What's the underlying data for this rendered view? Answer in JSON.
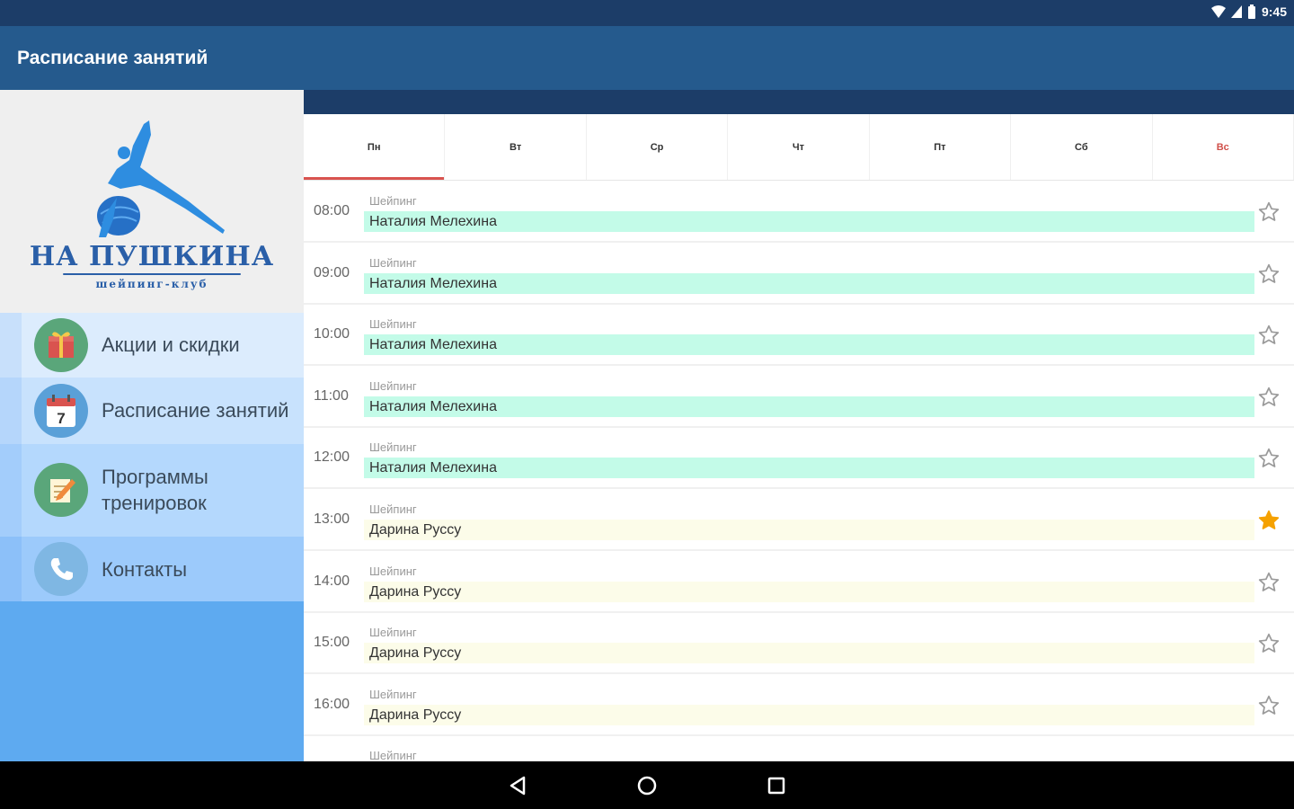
{
  "status_bar": {
    "time": "9:45"
  },
  "app_bar": {
    "title": "Расписание занятий"
  },
  "drawer": {
    "logo": {
      "title": "НА ПУШКИНА",
      "subtitle": "шейпинг-клуб"
    },
    "items": [
      {
        "label": "Акции и скидки",
        "icon": "gift-icon"
      },
      {
        "label": "Расписание занятий",
        "icon": "calendar-icon",
        "icon_number": "7"
      },
      {
        "label": "Программы тренировок",
        "icon": "notepad-pencil-icon"
      },
      {
        "label": "Контакты",
        "icon": "phone-icon"
      }
    ]
  },
  "days": [
    {
      "label": "Пн",
      "active": true
    },
    {
      "label": "Вт"
    },
    {
      "label": "Ср"
    },
    {
      "label": "Чт"
    },
    {
      "label": "Пт"
    },
    {
      "label": "Сб"
    },
    {
      "label": "Вс",
      "weekend": true
    }
  ],
  "schedule": [
    {
      "time": "08:00",
      "type": "Шейпинг",
      "trainer": "Наталия Мелехина",
      "color": "teal",
      "favorite": false
    },
    {
      "time": "09:00",
      "type": "Шейпинг",
      "trainer": "Наталия Мелехина",
      "color": "teal",
      "favorite": false
    },
    {
      "time": "10:00",
      "type": "Шейпинг",
      "trainer": "Наталия Мелехина",
      "color": "teal",
      "favorite": false
    },
    {
      "time": "11:00",
      "type": "Шейпинг",
      "trainer": "Наталия Мелехина",
      "color": "teal",
      "favorite": false
    },
    {
      "time": "12:00",
      "type": "Шейпинг",
      "trainer": "Наталия Мелехина",
      "color": "teal",
      "favorite": false
    },
    {
      "time": "13:00",
      "type": "Шейпинг",
      "trainer": "Дарина Руссу",
      "color": "cream",
      "favorite": true
    },
    {
      "time": "14:00",
      "type": "Шейпинг",
      "trainer": "Дарина Руссу",
      "color": "cream",
      "favorite": false
    },
    {
      "time": "15:00",
      "type": "Шейпинг",
      "trainer": "Дарина Руссу",
      "color": "cream",
      "favorite": false
    },
    {
      "time": "16:00",
      "type": "Шейпинг",
      "trainer": "Дарина Руссу",
      "color": "cream",
      "favorite": false
    },
    {
      "time": "",
      "type": "Шейпинг",
      "trainer": "",
      "color": "cream",
      "favorite": false
    }
  ],
  "colors": {
    "primary": "#255a8d",
    "primary_dark": "#1c3d68",
    "drawer_bg": "#5eaaf0",
    "accent_tab": "#d9534f",
    "teal_bar": "#c3fbe8",
    "cream_bar": "#fcfce9",
    "star_active": "#f5a100"
  },
  "nav": {
    "back": "back-icon",
    "home": "home-icon",
    "recents": "recents-icon"
  }
}
